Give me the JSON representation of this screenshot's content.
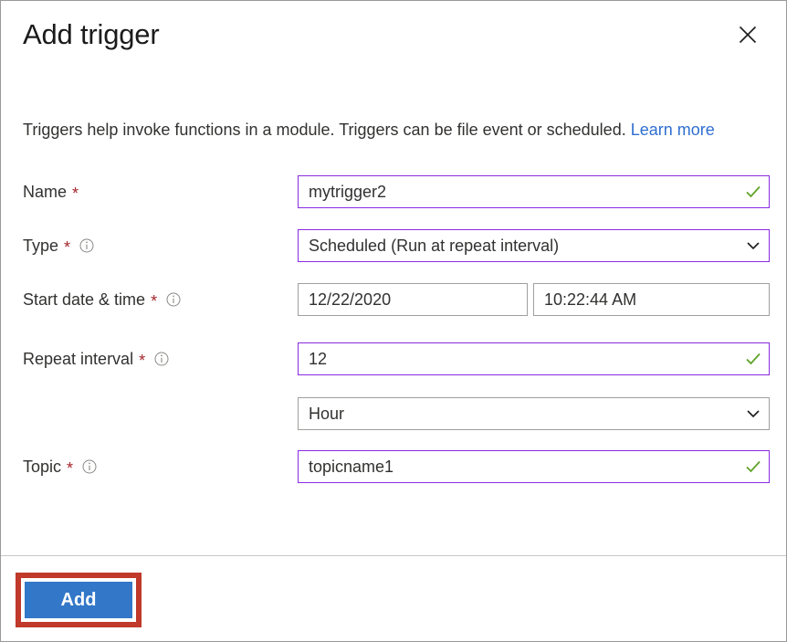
{
  "dialog": {
    "title": "Add trigger",
    "close_icon": "close-icon",
    "description_prefix": "Triggers help invoke functions in a module. Triggers can be file event or scheduled.",
    "learn_more_label": "Learn more"
  },
  "form": {
    "rows": [
      {
        "label": "Name",
        "required_marker": "*",
        "has_info": false,
        "value": "mytrigger2",
        "state": "valid"
      },
      {
        "label": "Type",
        "required_marker": "*",
        "has_info": true,
        "value": "Scheduled (Run at repeat interval)",
        "state": "valid"
      },
      {
        "label": "Start date & time",
        "required_marker": "*",
        "has_info": true,
        "date_value": "12/22/2020",
        "time_value": "10:22:44 AM",
        "state": "plain"
      },
      {
        "label": "Repeat interval",
        "required_marker": "*",
        "has_info": true,
        "value": "12",
        "state": "valid"
      },
      {
        "label": "",
        "required_marker": "",
        "has_info": false,
        "value": "Hour",
        "state": "plain"
      },
      {
        "label": "Topic",
        "required_marker": "*",
        "has_info": true,
        "value": "topicname1",
        "state": "valid"
      }
    ]
  },
  "footer": {
    "add_label": "Add"
  },
  "colors": {
    "accent_button": "#3277c8",
    "highlight_box": "#c0392b",
    "valid_border": "#8a2be2",
    "check_green": "#5ea326",
    "required_red": "#a4262c",
    "link_blue": "#2f6fd0"
  }
}
